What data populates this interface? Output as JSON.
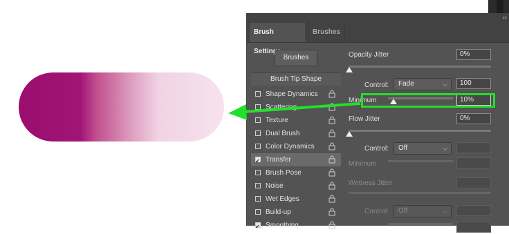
{
  "colors": {
    "accent_green": "#22e02a",
    "stroke_magenta": "#9b0d6f",
    "panel_bg": "#535353"
  },
  "tabs": {
    "active": "Brush Settings",
    "inactive": "Brushes"
  },
  "brushes_button": "Brushes",
  "list": {
    "title": "Brush Tip Shape",
    "items": [
      {
        "label": "Shape Dynamics",
        "checked": false,
        "icon": "lock-icon"
      },
      {
        "label": "Scattering",
        "checked": false,
        "icon": "lock-icon"
      },
      {
        "label": "Texture",
        "checked": false,
        "icon": "lock-icon"
      },
      {
        "label": "Dual Brush",
        "checked": false,
        "icon": "lock-icon"
      },
      {
        "label": "Color Dynamics",
        "checked": false,
        "icon": "lock-icon"
      },
      {
        "label": "Transfer",
        "checked": true,
        "selected": true,
        "icon": "lock-icon"
      },
      {
        "label": "Brush Pose",
        "checked": false,
        "icon": "lock-icon"
      },
      {
        "label": "Noise",
        "checked": false,
        "icon": "lock-icon"
      },
      {
        "label": "Wet Edges",
        "checked": false,
        "icon": "lock-icon"
      },
      {
        "label": "Build-up",
        "checked": false,
        "icon": "lock-icon"
      },
      {
        "label": "Smoothing",
        "checked": true,
        "icon": "lock-icon"
      }
    ]
  },
  "opacity": {
    "jitter_label": "Opacity Jitter",
    "jitter_value": "0%",
    "control_label": "Control:",
    "control_value": "Fade",
    "fade_steps": "100",
    "minimum_label": "Minimum",
    "minimum_value": "10%"
  },
  "flow": {
    "jitter_label": "Flow Jitter",
    "jitter_value": "0%",
    "control_label": "Control:",
    "control_value": "Off",
    "minimum_label": "Minimum"
  },
  "wetness": {
    "jitter_label": "Wetness Jitter",
    "control_label": "Control:",
    "control_value": "Off"
  }
}
